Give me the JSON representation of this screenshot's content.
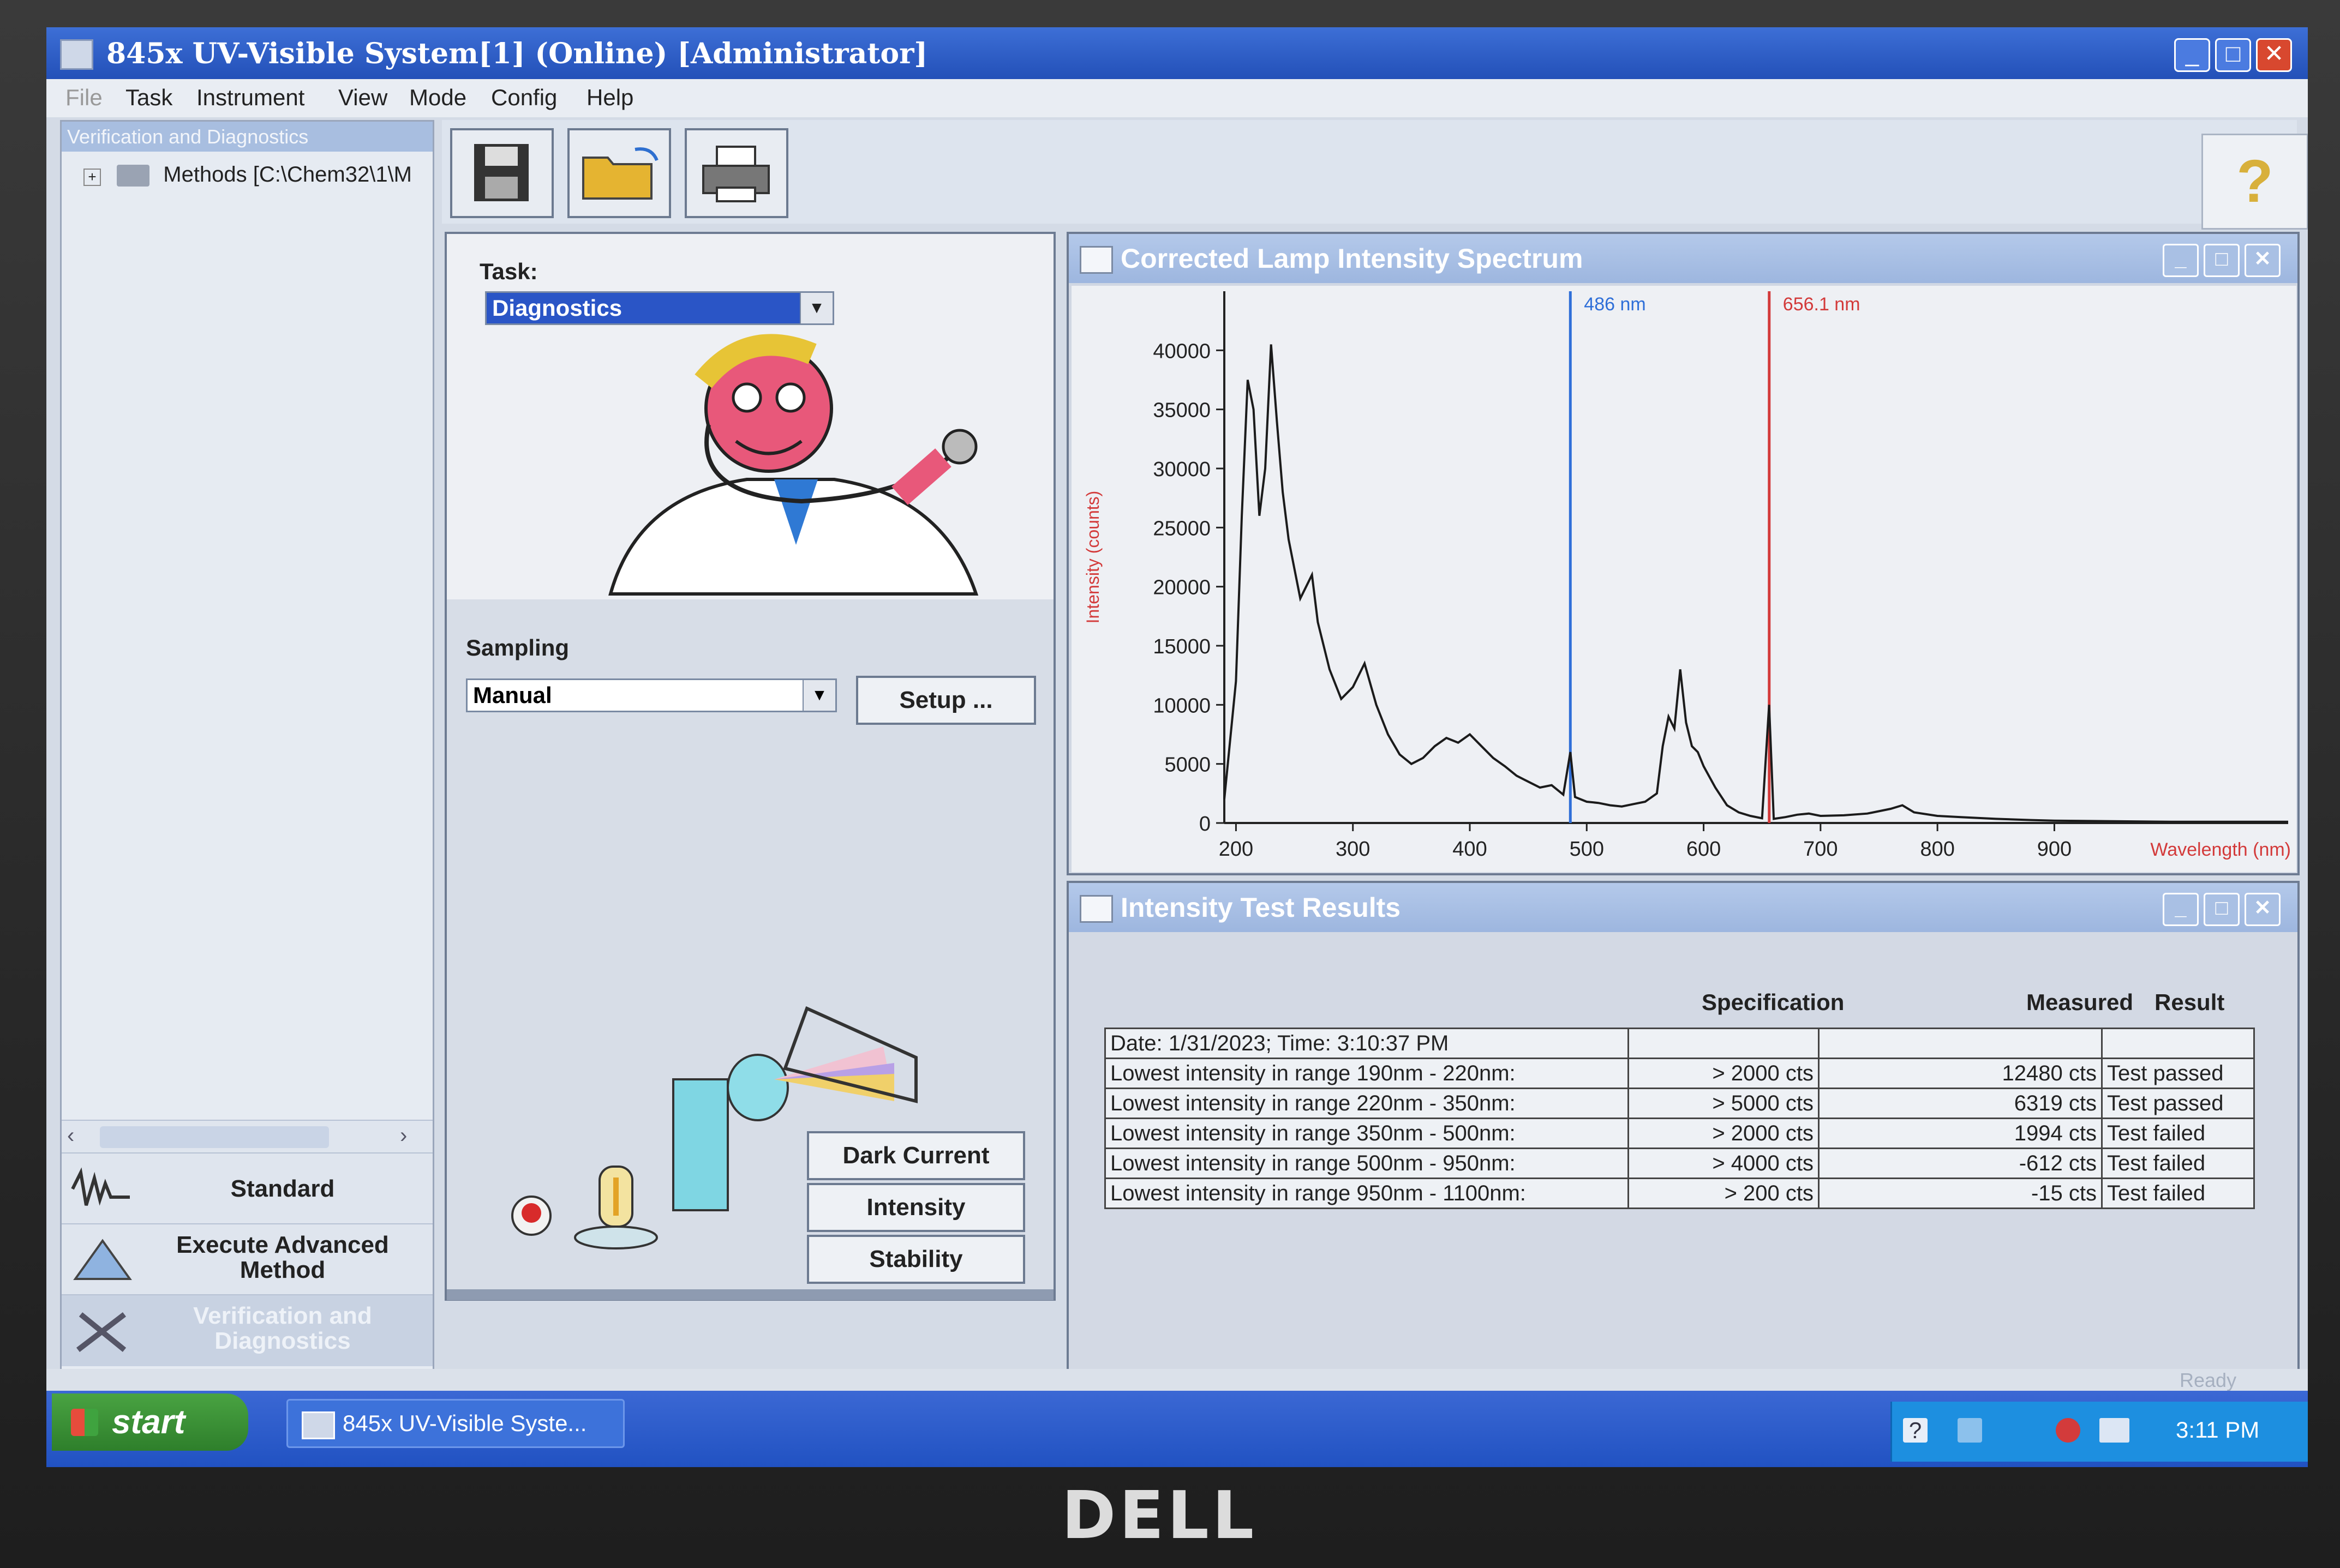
{
  "window": {
    "title": "845x UV-Visible System[1] (Online) [Administrator]",
    "min": "_",
    "max": "□",
    "close": "✕"
  },
  "menu": [
    "File",
    "Task",
    "Instrument",
    "View",
    "Mode",
    "Config",
    "Help"
  ],
  "left_pane": {
    "header": "Verification and Diagnostics",
    "tree_item": "Methods [C:\\Chem32\\1\\M",
    "nav": [
      {
        "label": "Standard",
        "icon": "waveform-icon"
      },
      {
        "label": "Execute Advanced Method",
        "icon": "flask-icon"
      },
      {
        "label": "Verification and Diagnostics",
        "icon": "tools-icon"
      }
    ]
  },
  "toolbar": {
    "buttons": [
      "save-icon",
      "open-folder-icon",
      "print-icon"
    ],
    "help": "?"
  },
  "task_panel": {
    "task_label": "Task:",
    "task_value": "Diagnostics",
    "sampling_label": "Sampling",
    "sampling_value": "Manual",
    "setup_button": "Setup ...",
    "buttons": [
      "Dark Current",
      "Intensity",
      "Stability"
    ]
  },
  "spectrum_window": {
    "title": "Corrected Lamp Intensity Spectrum"
  },
  "chart_data": {
    "type": "line",
    "title": "Corrected Lamp Intensity Spectrum",
    "xlabel": "Wavelength (nm)",
    "ylabel": "Intensity (counts)",
    "xlim": [
      190,
      1100
    ],
    "ylim": [
      0,
      45000
    ],
    "x_ticks": [
      200,
      300,
      400,
      500,
      600,
      700,
      800,
      900
    ],
    "y_ticks": [
      0,
      5000,
      10000,
      15000,
      20000,
      25000,
      30000,
      35000,
      40000
    ],
    "markers": [
      {
        "x": 486,
        "label": "486 nm",
        "color": "#2f6fd8"
      },
      {
        "x": 656.1,
        "label": "656.1 nm",
        "color": "#d33a3a"
      }
    ],
    "series": [
      {
        "color": "#1b1b1b",
        "x": [
          190,
          200,
          205,
          210,
          215,
          220,
          225,
          230,
          235,
          240,
          245,
          250,
          255,
          260,
          265,
          270,
          280,
          290,
          300,
          310,
          320,
          330,
          340,
          350,
          360,
          370,
          380,
          390,
          400,
          410,
          420,
          430,
          440,
          450,
          460,
          470,
          480,
          486,
          490,
          500,
          510,
          520,
          530,
          540,
          550,
          560,
          565,
          570,
          575,
          580,
          585,
          590,
          595,
          600,
          610,
          620,
          630,
          640,
          650,
          656,
          660,
          670,
          680,
          690,
          700,
          720,
          740,
          760,
          770,
          780,
          800,
          820,
          850,
          880,
          900,
          950,
          1000,
          1050,
          1100
        ],
        "y": [
          2000,
          12000,
          26000,
          37500,
          35000,
          26000,
          30000,
          40500,
          34000,
          28000,
          24000,
          21500,
          19000,
          20000,
          21000,
          17000,
          13000,
          10500,
          11500,
          13500,
          10000,
          7500,
          5800,
          5000,
          5500,
          6500,
          7200,
          6800,
          7500,
          6500,
          5500,
          4800,
          4000,
          3500,
          3000,
          3200,
          2400,
          6000,
          2200,
          1800,
          1700,
          1500,
          1400,
          1600,
          1800,
          2500,
          6500,
          9000,
          8000,
          13000,
          8500,
          6500,
          6000,
          4800,
          3000,
          1500,
          900,
          600,
          400,
          10000,
          350,
          500,
          700,
          800,
          600,
          650,
          800,
          1200,
          1500,
          900,
          600,
          500,
          350,
          250,
          200,
          150,
          100,
          100,
          100
        ]
      }
    ]
  },
  "results_window": {
    "title": "Intensity Test Results",
    "col_spec": "Specification",
    "col_measured": "Measured",
    "col_result": "Result",
    "date_row": "Date: 1/31/2023;  Time: 3:10:37 PM",
    "rows": [
      {
        "test": "Lowest intensity in range 190nm - 220nm:",
        "spec": "> 2000 cts",
        "measured": "12480 cts",
        "result": "Test passed"
      },
      {
        "test": "Lowest intensity in range 220nm - 350nm:",
        "spec": "> 5000 cts",
        "measured": "6319 cts",
        "result": "Test passed"
      },
      {
        "test": "Lowest intensity in range 350nm - 500nm:",
        "spec": "> 2000 cts",
        "measured": "1994 cts",
        "result": "Test failed"
      },
      {
        "test": "Lowest intensity in range 500nm - 950nm:",
        "spec": "> 4000 cts",
        "measured": "-612 cts",
        "result": "Test failed"
      },
      {
        "test": "Lowest intensity in range 950nm - 1100nm:",
        "spec": "> 200 cts",
        "measured": "-15 cts",
        "result": "Test failed"
      }
    ]
  },
  "status": "Ready",
  "taskbar": {
    "start": "start",
    "item": "845x UV-Visible Syste...",
    "clock": "3:11 PM"
  },
  "bezel_logo": "DELL"
}
